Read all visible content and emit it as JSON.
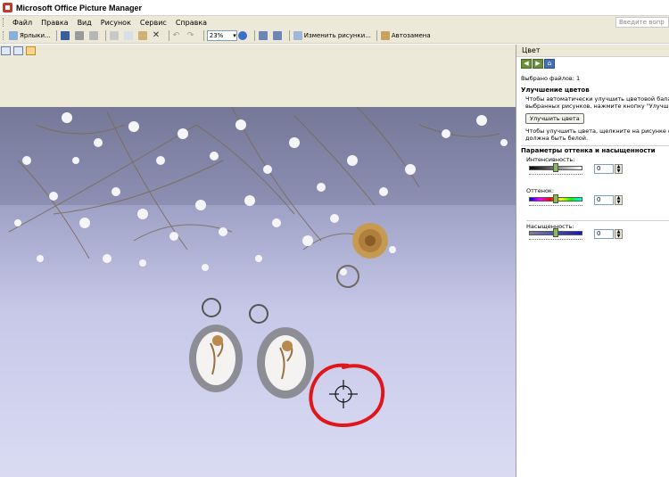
{
  "window": {
    "title": "Microsoft Office Picture Manager"
  },
  "menu": {
    "items": [
      "Файл",
      "Правка",
      "Вид",
      "Рисунок",
      "Сервис",
      "Справка"
    ],
    "help_placeholder": "Введите вопр"
  },
  "toolbar": {
    "shortcuts_label": "Ярлыки...",
    "zoom_value": "23%",
    "edit_pictures_label": "Изменить рисунки...",
    "autocorrect_label": "Автозамена"
  },
  "task_pane": {
    "title": "Цвет",
    "nav": [
      "back",
      "forward",
      "home"
    ],
    "selected_files": "Выбрано файлов: 1",
    "enhance_heading": "Улучшение цветов",
    "enhance_text_1": "Чтобы автоматически улучшить цветовой баланс",
    "enhance_text_2": "выбранных рисунков, нажмите кнопку \"Улучшить",
    "enhance_button": "Улучшить цвета",
    "click_text_1": "Чтобы улучшить цвета, щелкните на рисунке обл",
    "click_text_2": "должна быть белой.",
    "hue_sat_heading": "Параметры оттенка и насыщенности",
    "sliders": [
      {
        "label": "Интенсивность:",
        "value": "0",
        "level": 0.5
      },
      {
        "label": "Оттенок:",
        "value": "0",
        "level": 0.5
      },
      {
        "label": "Насыщенность:",
        "value": "0",
        "level": 0.5
      }
    ]
  },
  "colors": {
    "annotation_circle": "#e0171a",
    "photo_bg": "#c7c8e8",
    "toolbar_bg": "#ece9d8"
  }
}
